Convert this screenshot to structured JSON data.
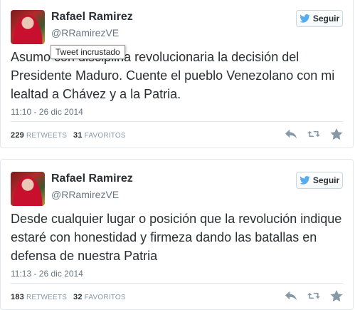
{
  "tweets": [
    {
      "name": "Rafael Ramirez",
      "handle": "@RRamirezVE",
      "follow_label": "Seguir",
      "text": "Asumo con disciplina revolucionaria la decisión del Presidente Maduro. Cuente el pueblo Venezolano con mi lealtad a Chávez y a la Patria.",
      "timestamp": "11:10 - 26 dic 2014",
      "retweets_count": "229",
      "retweets_label": "RETWEETS",
      "favorites_count": "31",
      "favorites_label": "FAVORITOS"
    },
    {
      "name": "Rafael Ramirez",
      "handle": "@RRamirezVE",
      "follow_label": "Seguir",
      "text": "Desde cualquier lugar o posición que la revolución indique estaré con honestidad y firmeza dando las batallas en defensa de nuestra Patria",
      "timestamp": "11:13 - 26 dic 2014",
      "retweets_count": "183",
      "retweets_label": "RETWEETS",
      "favorites_count": "32",
      "favorites_label": "FAVORITOS"
    }
  ],
  "tooltip": "Tweet incrustado",
  "icons": [
    "twitter-bird-icon",
    "reply-icon",
    "retweet-icon",
    "favorite-star-icon"
  ],
  "colors": {
    "bird": "#55acee",
    "muted": "#8899a6",
    "text": "#292f33"
  }
}
